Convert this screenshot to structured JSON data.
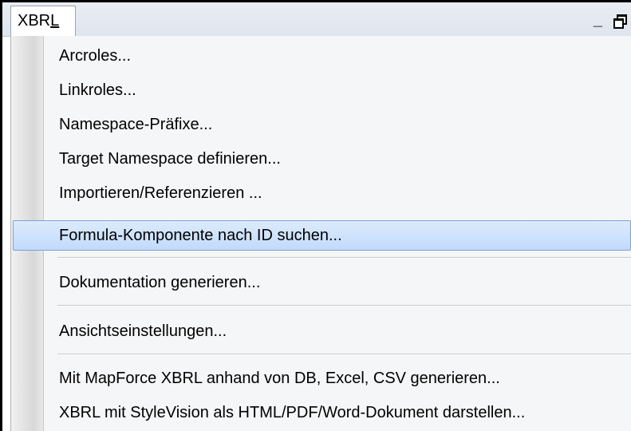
{
  "menubar": {
    "title_prefix": "XBR",
    "title_underlined": "L",
    "minimize_label": "_"
  },
  "menu": {
    "items": [
      {
        "label": "Arcroles..."
      },
      {
        "label": "Linkroles..."
      },
      {
        "label": "Namespace-Präfixe..."
      },
      {
        "label": "Target Namespace definieren..."
      },
      {
        "label": "Importieren/Referenzieren ..."
      },
      {
        "label": "Formula-Komponente nach ID suchen...",
        "highlighted": true
      },
      {
        "label": "Dokumentation generieren..."
      },
      {
        "label": "Ansichtseinstellungen..."
      },
      {
        "label": "Mit MapForce XBRL anhand von DB, Excel, CSV generieren..."
      },
      {
        "label": "XBRL mit StyleVision als HTML/PDF/Word-Dokument darstellen..."
      }
    ]
  }
}
